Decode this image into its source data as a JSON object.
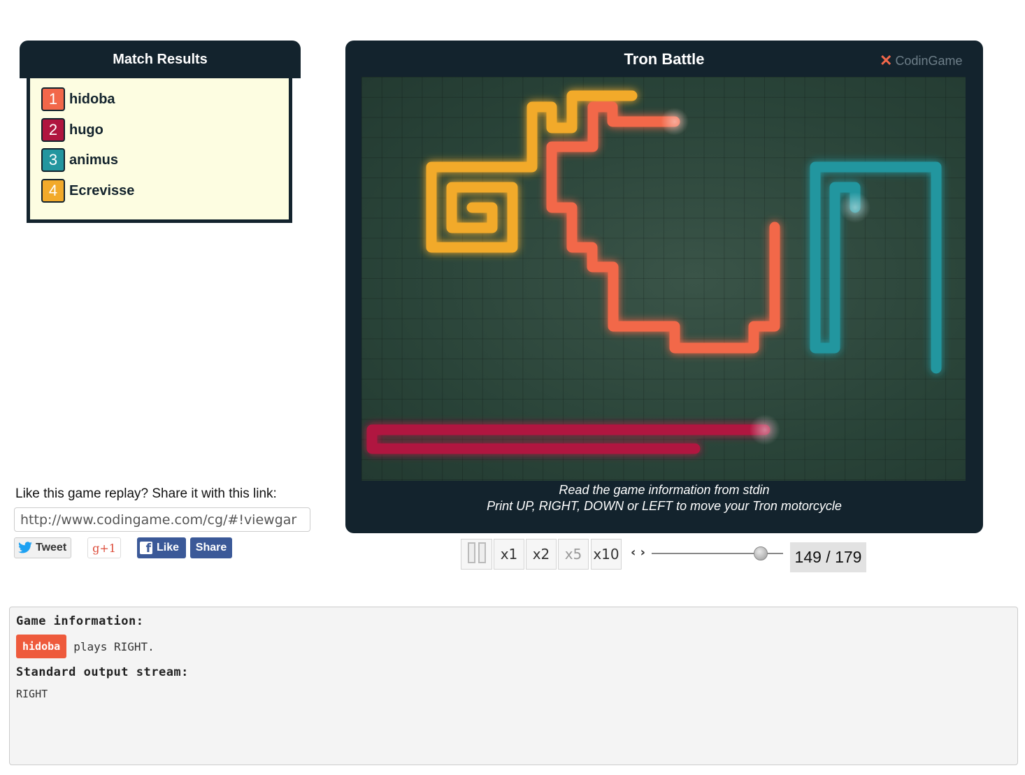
{
  "match_results": {
    "title": "Match Results",
    "players": [
      {
        "rank": "1",
        "name": "hidoba",
        "color": "#f2674a"
      },
      {
        "rank": "2",
        "name": "hugo",
        "color": "#b0153f"
      },
      {
        "rank": "3",
        "name": "animus",
        "color": "#23969f"
      },
      {
        "rank": "4",
        "name": "Ecrevisse",
        "color": "#f2aa2a"
      }
    ]
  },
  "share": {
    "prompt": "Like this game replay? Share it with this link:",
    "link": "http://www.codingame.com/cg/#!viewgar",
    "tweet_label": "Tweet",
    "gplus_label": "g+1",
    "fb_like_label": "Like",
    "fb_share_label": "Share"
  },
  "viewer": {
    "title": "Tron Battle",
    "brand": "CodinGame",
    "info_line1": "Read the game information from stdin",
    "info_line2": "Print UP, RIGHT, DOWN or LEFT to move your Tron motorcycle"
  },
  "controls": {
    "speeds": [
      "x1",
      "x2",
      "x5",
      "x10"
    ],
    "active_speed": "x5",
    "step_label": "‹ ›",
    "current_frame": 149,
    "total_frames": 179,
    "frame_display": "149 / 179"
  },
  "game_info": {
    "heading": "Game information:",
    "player": "hidoba",
    "player_color": "#ee5a3c",
    "action": "plays RIGHT.",
    "stdout_heading": "Standard output stream:",
    "stdout": "RIGHT"
  },
  "icons": [
    "codingame-logo-icon",
    "twitter-bird-icon",
    "facebook-icon",
    "pause-icon",
    "step-arrows-icon",
    "slider-knob"
  ]
}
